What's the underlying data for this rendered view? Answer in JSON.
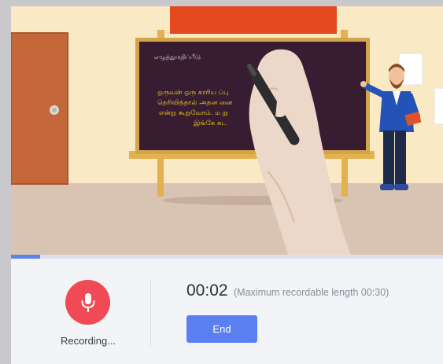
{
  "scene": {
    "board_title": "எழுத்துமதிப்பீடு",
    "board_lines": [
      "ஒருவன் ஒரு காரிய      ப்பு",
      "தெரிவித்தால் அதன      னை",
      "என்று கூறுவோம். ம      று",
      "இங்கே சுட"
    ]
  },
  "recording": {
    "progress": 0.067,
    "status_label": "Recording...",
    "timer": "00:02",
    "max_note": "(Maximum recordable length 00:30)",
    "end_label": "End"
  },
  "icons": {
    "mic": "microphone-icon"
  },
  "colors": {
    "record_red": "#ef4a55",
    "accent_blue": "#5a7ff1",
    "progress_blue": "#5b84ee"
  }
}
